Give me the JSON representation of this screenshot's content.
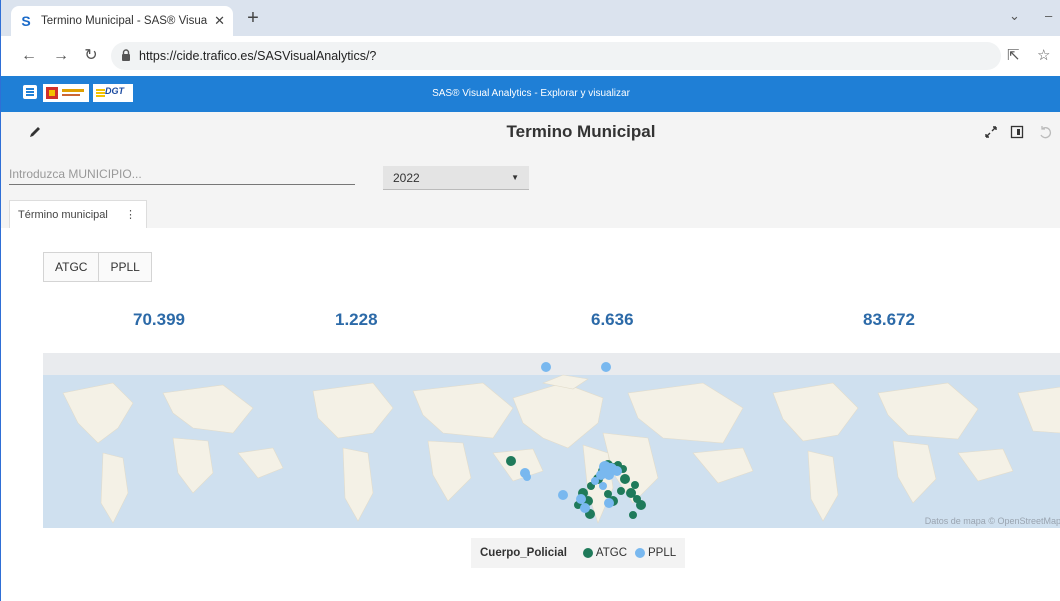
{
  "browser": {
    "tab_title": "Termino Municipal - SAS® Visua",
    "url": "https://cide.trafico.es/SASVisualAnalytics/?",
    "new_tab_symbol": "+",
    "tab_close_symbol": "✕"
  },
  "app_header": {
    "title": "SAS® Visual Analytics - Explorar y visualizar",
    "logo_dgt": "DGT"
  },
  "report": {
    "title": "Termino Municipal"
  },
  "filters": {
    "municipio_placeholder": "Introduzca MUNICIPIO...",
    "year_value": "2022"
  },
  "page_tabs": [
    {
      "label": "Término municipal",
      "menu": "⋮"
    }
  ],
  "toggle_buttons": [
    "ATGC",
    "PPLL"
  ],
  "kpis": [
    "70.399",
    "1.228",
    "6.636",
    "83.672"
  ],
  "map": {
    "attribution": "Datos de mapa © OpenStreetMap",
    "legend_title": "Cuerpo_Policial",
    "legend_items": [
      {
        "label": "ATGC",
        "color": "#1f7a5a"
      },
      {
        "label": "PPLL",
        "color": "#79b8ef"
      }
    ]
  },
  "colors": {
    "sas_blue": "#1f7fd6",
    "kpi_blue": "#2c6aa8",
    "atgc_green": "#1f7a5a",
    "ppll_blue": "#79b8ef"
  }
}
